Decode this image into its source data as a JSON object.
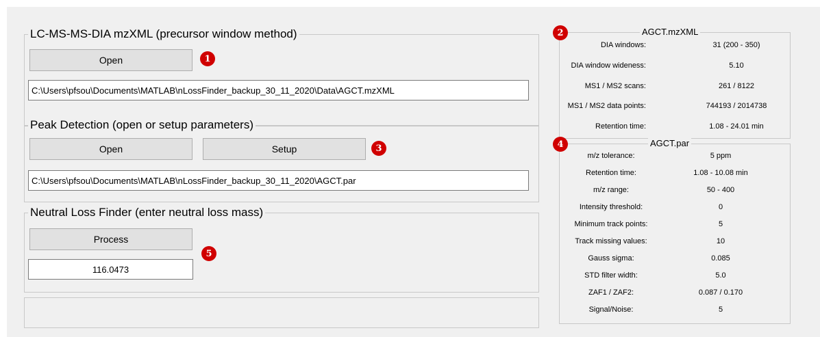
{
  "lcms": {
    "title": "LC-MS-MS-DIA mzXML (precursor window method)",
    "open_label": "Open",
    "path": "C:\\Users\\pfsou\\Documents\\MATLAB\\nLossFinder_backup_30_11_2020\\Data\\AGCT.mzXML",
    "badge": "1"
  },
  "peak": {
    "title": "Peak Detection (open or setup parameters)",
    "open_label": "Open",
    "setup_label": "Setup",
    "path": "C:\\Users\\pfsou\\Documents\\MATLAB\\nLossFinder_backup_30_11_2020\\AGCT.par",
    "badge": "3"
  },
  "nlf": {
    "title": "Neutral Loss Finder (enter neutral loss mass)",
    "process_label": "Process",
    "mass": "116.0473",
    "badge": "5"
  },
  "status": {
    "text": ""
  },
  "mzxml_panel": {
    "title": "AGCT.mzXML",
    "badge": "2",
    "rows": [
      {
        "label": "DIA windows:",
        "value": "31 (200 - 350)"
      },
      {
        "label": "DIA window wideness:",
        "value": "5.10"
      },
      {
        "label": "MS1 / MS2 scans:",
        "value": "261 / 8122"
      },
      {
        "label": "MS1 / MS2 data points:",
        "value": "744193 / 2014738"
      },
      {
        "label": "Retention time:",
        "value": "1.08 - 24.01 min"
      }
    ]
  },
  "par_panel": {
    "title": "AGCT.par",
    "badge": "4",
    "rows": [
      {
        "label": "m/z tolerance:",
        "value": "5 ppm"
      },
      {
        "label": "Retention time:",
        "value": "1.08 - 10.08 min"
      },
      {
        "label": "m/z range:",
        "value": "50 - 400"
      },
      {
        "label": "Intensity threshold:",
        "value": "0"
      },
      {
        "label": "Minimum track points:",
        "value": "5"
      },
      {
        "label": "Track missing values:",
        "value": "10"
      },
      {
        "label": "Gauss sigma:",
        "value": "0.085"
      },
      {
        "label": "STD filter width:",
        "value": "5.0"
      },
      {
        "label": "ZAF1 / ZAF2:",
        "value": "0.087 / 0.170"
      },
      {
        "label": "Signal/Noise:",
        "value": "5"
      }
    ]
  },
  "colors": {
    "background": "#f0f0f0",
    "button": "#e1e1e1",
    "badge": "#d00000"
  }
}
